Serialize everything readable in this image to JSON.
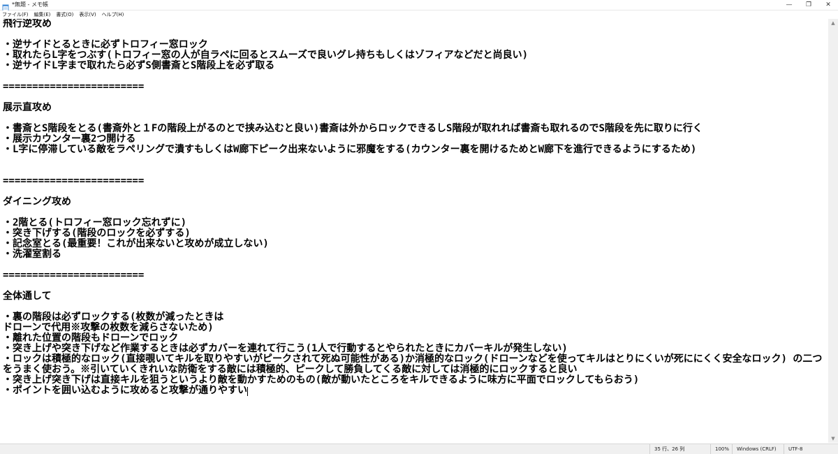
{
  "window": {
    "title": "*無題 - メモ帳",
    "controls": {
      "minimize": "—",
      "maximize": "❐",
      "close": "✕"
    }
  },
  "menu": {
    "items": [
      "ファイル(F)",
      "編集(E)",
      "書式(O)",
      "表示(V)",
      "ヘルプ(H)"
    ]
  },
  "editor": {
    "content": "飛行逆攻め\n\n・逆サイドとるときに必ずトロフィー窓ロック\n・取れたらL字をつぶす(トロフィー窓の人が自ラペに回るとスムーズで良いグレ持ちもしくはゾフィアなどだと尚良い)\n・逆サイドL字まで取れたら必ずS側書斎とS階段上を必ず取る\n\n========================\n\n展示直攻め\n\n・書斎とS階段をとる(書斎外と１Fの階段上がるのとで挟み込むと良い)書斎は外からロックできるしS階段が取れれば書斎も取れるのでS階段を先に取りに行く\n・展示カウンター裏2つ開ける\n・L字に停滞している敵をラペリングで潰すもしくはW廊下ピーク出来ないように邪魔をする(カウンター裏を開けるためとW廊下を進行できるようにするため)\n\n\n========================\n\nダイニング攻め\n\n・2階とる(トロフィー窓ロック忘れずに)\n・突き下げする(階段のロックを必ずする)\n・記念室とる(最重要！これが出来ないと攻めが成立しない)\n・洗濯室割る\n\n========================\n\n全体通して\n\n・裏の階段は必ずロックする(枚数が減ったときは\nドローンで代用※攻撃の枚数を減らさないため)\n・離れた位置の階段もドローンでロック\n・突き上げや突き下げなど作業するときは必ずカバーを連れて行こう(1人で行動するとやられたときにカバーキルが発生しない)\n・ロックは積極的なロック(直接覗いてキルを取りやすいがピークされて死ぬ可能性がある)か消極的なロック(ドローンなどを使ってキルはとりにくいが死ににくく安全なロック) の二つをうまく使おう。※引いていくきれいな防衛をする敵には積極的、ピークして勝負してくる敵に対しては消極的にロックすると良い\n・突き上げ突き下げは直接キルを狙うというより敵を動かすためのもの(敵が動いたところをキルできるように味方に平面でロックしてもらおう)\n・ポイントを囲い込むように攻めると攻撃が通りやすい"
  },
  "status": {
    "position": "35 行、26 列",
    "zoom": "100%",
    "line_ending": "Windows (CRLF)",
    "encoding": "UTF-8"
  },
  "colors": {
    "app_icon": "#4a90d9",
    "background": "#ffffff",
    "statusbar": "#f0f0f0"
  }
}
